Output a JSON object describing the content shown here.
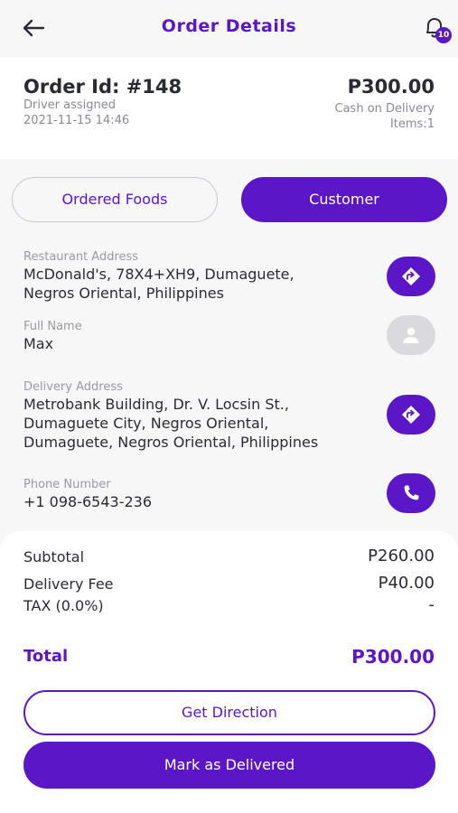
{
  "header": {
    "title": "Order Details",
    "notification_count": "10",
    "accent_color": "#5b16c8"
  },
  "order": {
    "id": "Order Id: #148",
    "status": "Driver assigned",
    "datetime": "2021-11-15 14:46",
    "total": "P300.00",
    "payment_method": "Cash on Delivery",
    "items": "Items:1"
  },
  "tabs": [
    {
      "label": "Ordered Foods",
      "active": false
    },
    {
      "label": "Customer",
      "active": true
    }
  ],
  "customer": {
    "restaurant_address_label": "Restaurant Address",
    "restaurant_address": "McDonald's, 78X4+XH9, Dumaguete,\nNegros Oriental, Philippines",
    "full_name_label": "Full Name",
    "full_name": "Max",
    "delivery_address_label": "Delivery Address",
    "delivery_address": "Metrobank Building, Dr. V. Locsin St.,\nDumaguete City, Negros Oriental,\nDumaguete, Negros Oriental, Philippines",
    "phone_label": "Phone Number",
    "phone": "+1 098-6543-236"
  },
  "summary": {
    "subtotal_label": "Subtotal",
    "subtotal": "P260.00",
    "delivery_fee_label": "Delivery Fee",
    "delivery_fee": "P40.00",
    "tax_label": "TAX (0.0%)",
    "tax": "-",
    "total_label": "Total",
    "total": "P300.00"
  },
  "actions": {
    "get_direction": "Get Direction",
    "mark_delivered": "Mark as Delivered"
  },
  "icons": [
    "back-arrow-icon",
    "bell-icon",
    "directions-icon",
    "person-icon",
    "phone-icon"
  ]
}
